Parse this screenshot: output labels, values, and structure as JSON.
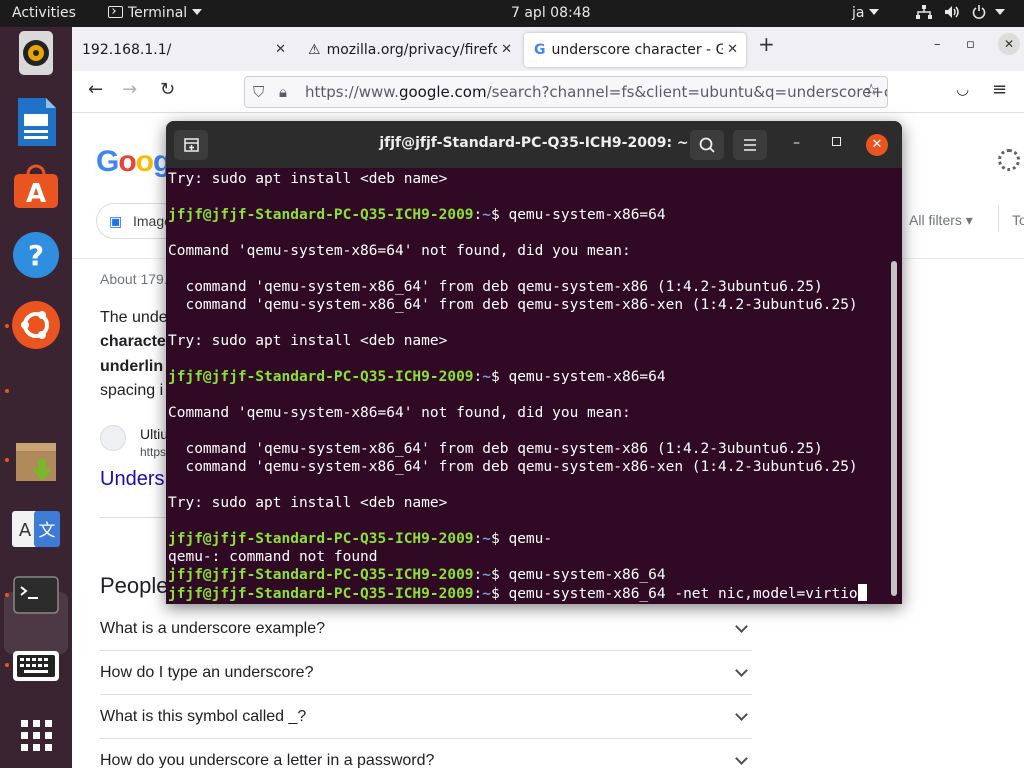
{
  "topbar": {
    "activities": "Activities",
    "app_name": "Terminal",
    "clock": "7 apl  08:48",
    "user": "ja"
  },
  "dock": {
    "items": [
      "rhythmbox",
      "libreoffice-writer",
      "ubuntu-software",
      "help",
      "ubuntu-settings",
      "archive-manager",
      "language-support",
      "terminal",
      "keyboard",
      "show-applications"
    ]
  },
  "browser": {
    "tabs": [
      {
        "title": "192.168.1.1/"
      },
      {
        "title": "mozilla.org/privacy/firefo"
      },
      {
        "title": "underscore character - G"
      }
    ],
    "new_tab": "+",
    "url_prefix": "https://www.",
    "url_domain": "google.com",
    "url_rest": "/search?channel=fs&client=ubuntu&q=underscore+ch"
  },
  "google": {
    "logo": "Goog",
    "chip_images": "Image",
    "all_filters": "All filters",
    "tools": "To",
    "about": "About 179.",
    "snippet_lines": [
      "The unde",
      "characte",
      "underlin",
      "spacing i"
    ],
    "site_name": "Ultiu",
    "site_url": "https",
    "result_link": "Unders",
    "people_heading": "People",
    "questions": [
      "What is a underscore example?",
      "How do I type an underscore?",
      "What is this symbol called _?",
      "How do you underscore a letter in a password?"
    ]
  },
  "terminal": {
    "title": "jfjf@jfjf-Standard-PC-Q35-ICH9-2009: ~",
    "user_host": "jfjf@jfjf-Standard-PC-Q35-ICH9-2009",
    "path": "~",
    "lines": [
      {
        "t": "out",
        "text": "Try: sudo apt install <deb name>"
      },
      {
        "t": "blank"
      },
      {
        "t": "cmd",
        "text": "qemu-system-x86=64"
      },
      {
        "t": "blank"
      },
      {
        "t": "out",
        "text": "Command 'qemu-system-x86=64' not found, did you mean:"
      },
      {
        "t": "blank"
      },
      {
        "t": "out",
        "text": "  command 'qemu-system-x86_64' from deb qemu-system-x86 (1:4.2-3ubuntu6.25)"
      },
      {
        "t": "out",
        "text": "  command 'qemu-system-x86_64' from deb qemu-system-x86-xen (1:4.2-3ubuntu6.25)"
      },
      {
        "t": "blank"
      },
      {
        "t": "out",
        "text": "Try: sudo apt install <deb name>"
      },
      {
        "t": "blank"
      },
      {
        "t": "cmd",
        "text": "qemu-system-x86=64"
      },
      {
        "t": "blank"
      },
      {
        "t": "out",
        "text": "Command 'qemu-system-x86=64' not found, did you mean:"
      },
      {
        "t": "blank"
      },
      {
        "t": "out",
        "text": "  command 'qemu-system-x86_64' from deb qemu-system-x86 (1:4.2-3ubuntu6.25)"
      },
      {
        "t": "out",
        "text": "  command 'qemu-system-x86_64' from deb qemu-system-x86-xen (1:4.2-3ubuntu6.25)"
      },
      {
        "t": "blank"
      },
      {
        "t": "out",
        "text": "Try: sudo apt install <deb name>"
      },
      {
        "t": "blank"
      },
      {
        "t": "cmd",
        "text": "qemu-"
      },
      {
        "t": "out",
        "text": "qemu-: command not found"
      },
      {
        "t": "cmd",
        "text": "qemu-system-x86_64"
      },
      {
        "t": "cmd",
        "text": "qemu-system-x86_64 -net nic,model=virtio",
        "cursor": true
      }
    ]
  },
  "colors": {
    "terminal_bg": "#300a24",
    "prompt_user": "#8ae234",
    "prompt_path": "#729fcf",
    "accent": "#e95420"
  }
}
